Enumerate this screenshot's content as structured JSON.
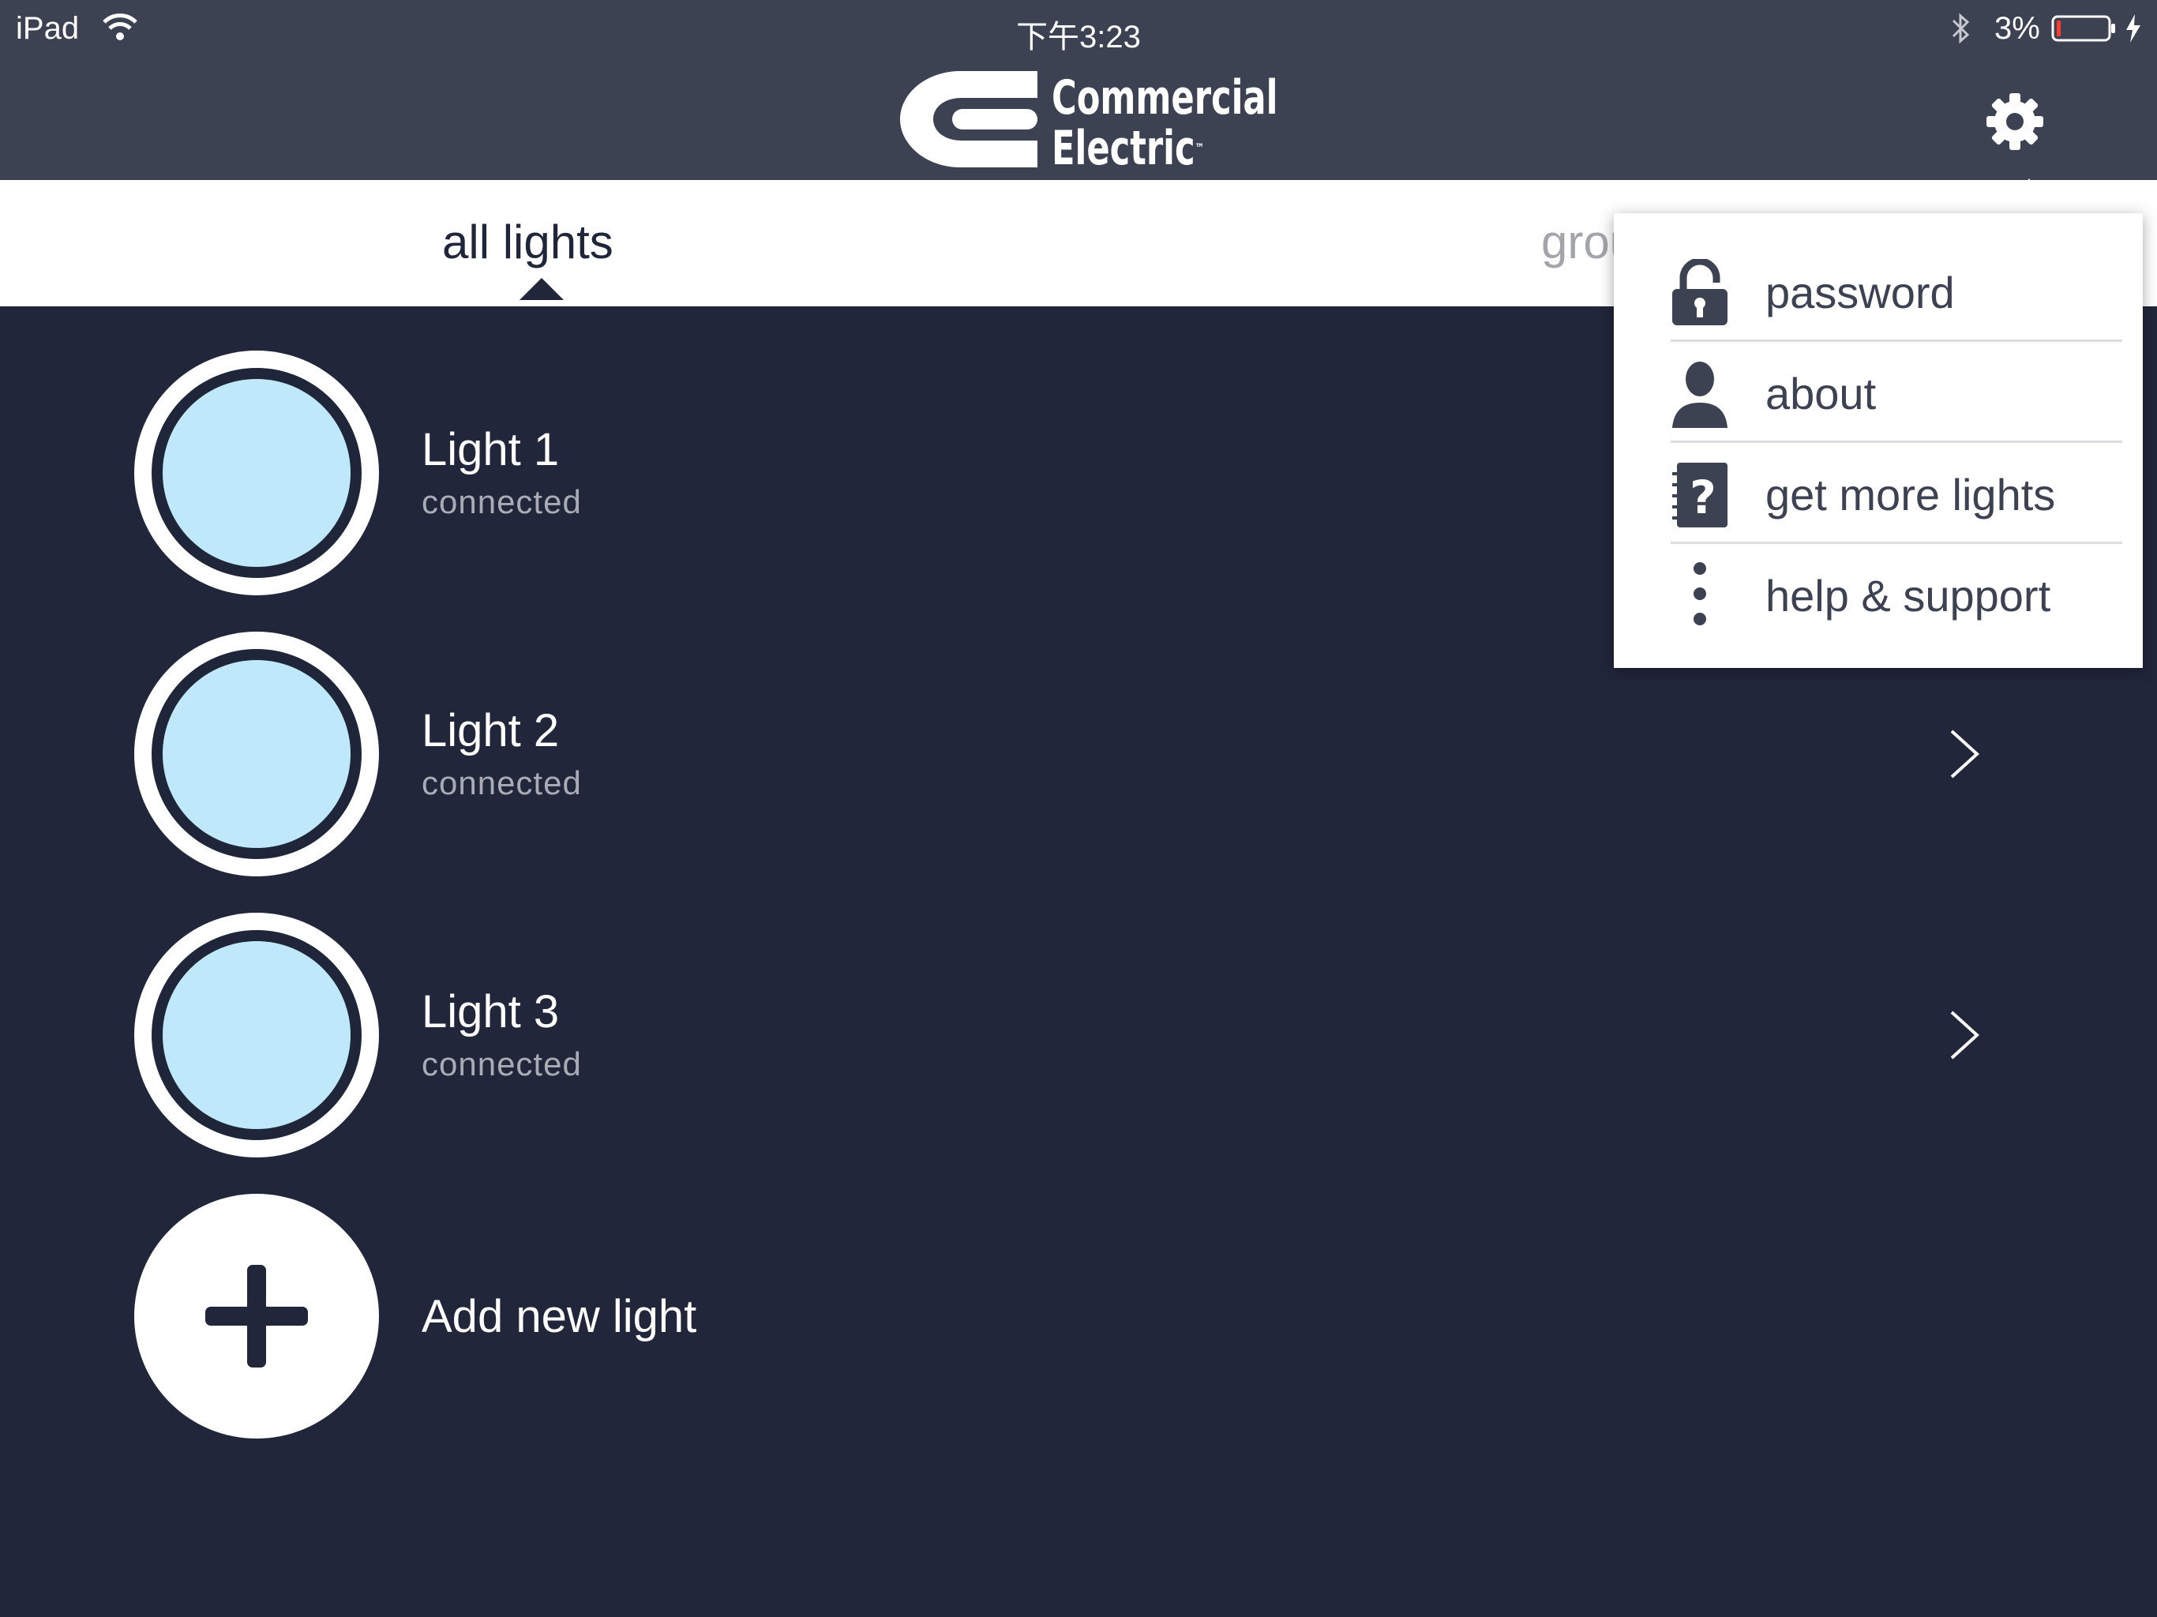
{
  "status_bar": {
    "device": "iPad",
    "time": "下午3:23",
    "battery_percent": "3%",
    "icons": [
      "wifi-icon",
      "bluetooth-icon",
      "battery-icon",
      "charging-icon"
    ]
  },
  "header": {
    "logo_line1": "Commercial",
    "logo_line2": "Electric",
    "logo_tm": "™",
    "settings_icon": "gear-icon"
  },
  "tabs": {
    "all_lights": "all lights",
    "groups": "groups"
  },
  "lights": [
    {
      "name": "Light 1",
      "status": "connected"
    },
    {
      "name": "Light 2",
      "status": "connected"
    },
    {
      "name": "Light 3",
      "status": "connected"
    }
  ],
  "add_light": {
    "label": "Add new light",
    "icon": "plus-icon"
  },
  "settings_menu": {
    "items": [
      {
        "label": "password",
        "icon": "padlock-icon"
      },
      {
        "label": "about",
        "icon": "person-icon"
      },
      {
        "label": "get more lights",
        "icon": "help-notebook-icon"
      },
      {
        "label": "help & support",
        "icon": "more-vertical-icon"
      }
    ]
  },
  "colors": {
    "header_bg": "#3d4253",
    "content_bg": "#22263a",
    "bulb_fill": "#bfe9fb",
    "text_primary": "#ffffff",
    "text_secondary": "#a9acb4",
    "tab_inactive": "#a3a5ab"
  }
}
